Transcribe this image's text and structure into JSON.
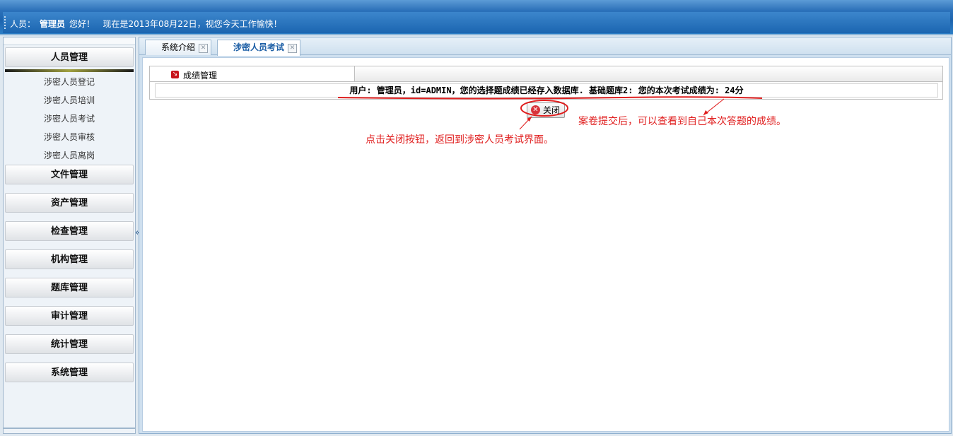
{
  "header": {
    "user_label": "人员：",
    "user_name": "管理员",
    "greeting": "您好！",
    "date_text": "现在是2013年08月22日，视您今天工作愉快！"
  },
  "sidebar": {
    "groups": [
      {
        "label": "人员管理",
        "active": true
      },
      {
        "label": "文件管理"
      },
      {
        "label": "资产管理"
      },
      {
        "label": "检查管理"
      },
      {
        "label": "机构管理"
      },
      {
        "label": "题库管理"
      },
      {
        "label": "审计管理"
      },
      {
        "label": "统计管理"
      },
      {
        "label": "系统管理"
      }
    ],
    "sub_items": [
      "涉密人员登记",
      "涉密人员培训",
      "涉密人员考试",
      "涉密人员审核",
      "涉密人员离岗"
    ],
    "collapse_glyph": "«"
  },
  "tabs": [
    {
      "label": "系统介绍",
      "active": false
    },
    {
      "label": "涉密人员考试",
      "active": true
    }
  ],
  "panel": {
    "title": "成绩管理",
    "result_text": "用户: 管理员，id=ADMIN，您的选择题成绩已经存入数据库. 基础题库2: 您的本次考试成绩为: 24分"
  },
  "close_button": {
    "label": "关闭"
  },
  "annotations": {
    "submit_note": "案卷提交后，可以查看到自己本次答题的成绩。",
    "close_note": "点击关闭按钮，返回到涉密人员考试界面。",
    "color": "#e01e1e"
  }
}
